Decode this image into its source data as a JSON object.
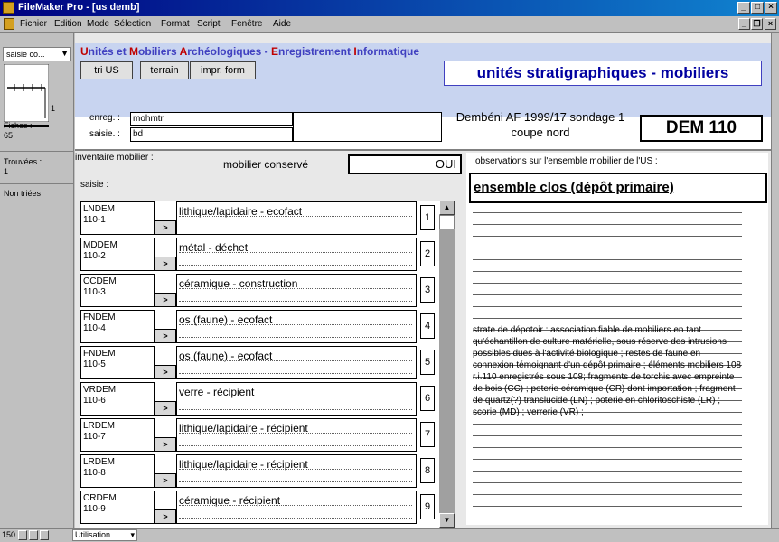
{
  "window": {
    "title": "FileMaker Pro - [us demb]"
  },
  "menu": [
    "Fichier",
    "Edition",
    "Mode",
    "Sélection",
    "Format",
    "Script",
    "Fenêtre",
    "Aide"
  ],
  "status": {
    "layout_menu": "saisie co...",
    "record_number": "1",
    "fiches_label": "Fiches :",
    "fiches_count": "65",
    "trouvees_label": "Trouvées :",
    "trouvees_count": "1",
    "non_triees": "Non triées",
    "zoom": "150",
    "mode": "Utilisation"
  },
  "header": {
    "app_title_parts": [
      {
        "text": "U",
        "red": true
      },
      {
        "text": "nités et ",
        "red": false
      },
      {
        "text": "M",
        "red": true
      },
      {
        "text": "obiliers ",
        "red": false
      },
      {
        "text": "A",
        "red": true
      },
      {
        "text": "rchéologiques - ",
        "red": false
      },
      {
        "text": "E",
        "red": true
      },
      {
        "text": "nregistrement ",
        "red": false
      },
      {
        "text": "I",
        "red": true
      },
      {
        "text": "nformatique",
        "red": false
      }
    ],
    "buttons": [
      "tri US",
      "terrain",
      "impr. form"
    ],
    "section_title": "unités stratigraphiques - mobiliers"
  },
  "record": {
    "enreg_label": "enreg. :",
    "enreg_value": "mohmtr",
    "saisie_label": "saisie. :",
    "saisie_value": "bd",
    "site_line1": "Dembéni AF 1999/17 sondage 1",
    "site_line2": "coupe nord",
    "us_code": "DEM  110"
  },
  "inventory": {
    "title": "inventaire mobilier :",
    "conserve_label": "mobilier conservé",
    "conserve_value": "OUI",
    "saisie_label": "saisie :",
    "go_label": ">",
    "rows": [
      {
        "code1": "LNDEM",
        "code2": "110-1",
        "desc": "lithique/lapidaire - ecofact",
        "n": "1"
      },
      {
        "code1": "MDDEM",
        "code2": "110-2",
        "desc": "métal - déchet",
        "n": "2"
      },
      {
        "code1": "CCDEM",
        "code2": "110-3",
        "desc": "céramique - construction",
        "n": "3"
      },
      {
        "code1": "FNDEM",
        "code2": "110-4",
        "desc": "os (faune) - ecofact",
        "n": "4"
      },
      {
        "code1": "FNDEM",
        "code2": "110-5",
        "desc": "os (faune) - ecofact",
        "n": "5"
      },
      {
        "code1": "VRDEM",
        "code2": "110-6",
        "desc": "verre - récipient",
        "n": "6"
      },
      {
        "code1": "LRDEM",
        "code2": "110-7",
        "desc": "lithique/lapidaire - récipient",
        "n": "7"
      },
      {
        "code1": "LRDEM",
        "code2": "110-8",
        "desc": "lithique/lapidaire - récipient",
        "n": "8"
      },
      {
        "code1": "CRDEM",
        "code2": "110-9",
        "desc": "céramique - récipient",
        "n": "9"
      }
    ]
  },
  "observations": {
    "label": "observations sur l'ensemble mobilier de l'US :",
    "headline": "ensemble clos (dépôt primaire)",
    "text": "strate de dépotoir : association fiable de mobiliers en tant qu'échantillon de culture matérielle, sous réserve des intrusions possibles dues à l'activité biologique ; restes de faune  en connexion  témoignant d'un dépôt primaire ; éléments mobiliers 108 r.i.110 enregistrés sous 108; fragments de torchis avec empreinte de bois  (CC) ; poterie céramique (CR) dont importation ; fragment de quartz(?) translucide (LN) ; poterie en chloritoschiste (LR) ; scorie (MD) ; verrerie (VR) ;"
  }
}
